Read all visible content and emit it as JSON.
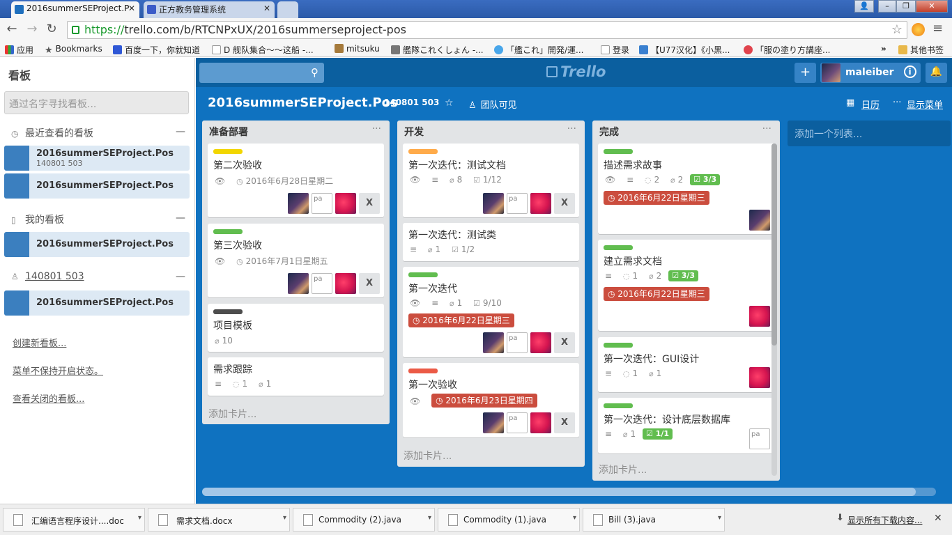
{
  "browser": {
    "tabs": [
      {
        "title": "2016summerSEProject.P",
        "active": true,
        "favicon": "trello-icon"
      },
      {
        "title": "正方教务管理系统",
        "active": false,
        "favicon": "jwxt-icon"
      }
    ],
    "url_https": "https://",
    "url_rest": "trello.com/b/RTCNPxUX/2016summerseproject-pos",
    "bookmarks": [
      {
        "label": "应用",
        "icon": "apps-icon"
      },
      {
        "label": "Bookmarks",
        "icon": "star-icon"
      },
      {
        "label": "百度一下，你就知道",
        "icon": "baidu-icon"
      },
      {
        "label": "D 舰队集合～～这船 -...",
        "icon": "page-icon"
      },
      {
        "label": "mitsuku",
        "icon": "mitsuku-icon"
      },
      {
        "label": "艦隊これくしょん -...",
        "icon": "kancolle-icon"
      },
      {
        "label": "「艦これ」開発/運...",
        "icon": "twitter-icon"
      },
      {
        "label": "登录",
        "icon": "page-icon"
      },
      {
        "label": "【U77汉化】《小黑...",
        "icon": "u77-icon"
      },
      {
        "label": "「服の塗り方講座...",
        "icon": "paint-icon"
      }
    ],
    "bookmarks_more": "»",
    "other_bookmarks": "其他书签"
  },
  "sidebar": {
    "title": "看板",
    "search_placeholder": "通过名字寻找看板...",
    "sections": [
      {
        "title": "最近查看的看板",
        "icon": "clock-icon",
        "underlined": false,
        "boards": [
          {
            "name": "2016summerSEProject.Pos",
            "sub": "140801 503"
          },
          {
            "name": "2016summerSEProject.Pos",
            "sub": ""
          }
        ]
      },
      {
        "title": "我的看板",
        "icon": "board-icon",
        "underlined": false,
        "boards": [
          {
            "name": "2016summerSEProject.Pos",
            "sub": ""
          }
        ]
      },
      {
        "title": "140801 503",
        "icon": "team-icon",
        "underlined": true,
        "boards": [
          {
            "name": "2016summerSEProject.Pos",
            "sub": ""
          }
        ]
      }
    ],
    "collapse_symbol": "—",
    "links": [
      "创建新看板...",
      "菜单不保持开启状态。",
      "查看关闭的看板..."
    ]
  },
  "header": {
    "logo_text": "Trello",
    "username": "maleiber",
    "add_symbol": "+",
    "info_symbol": "i",
    "bell_symbol": "🔔"
  },
  "board": {
    "title": "2016summerSEProject.Pos",
    "team": "140801 503",
    "visibility": "团队可见",
    "calendar": "日历",
    "show_menu": "显示菜单",
    "add_list": "添加一个列表...",
    "add_card": "添加卡片...",
    "list_menu": "···"
  },
  "lists": [
    {
      "title": "准备部署",
      "cards": [
        {
          "label_color": "#f2d600",
          "title": "第二次验收",
          "watch": true,
          "due": "2016年6月28日星期二",
          "due_style": "plain",
          "members": [
            "photo",
            "broken",
            "pink",
            "x"
          ]
        },
        {
          "label_color": "#61bd4f",
          "title": "第三次验收",
          "watch": true,
          "due": "2016年7月1日星期五",
          "due_style": "plain",
          "members": [
            "photo",
            "broken",
            "pink",
            "x"
          ]
        },
        {
          "label_color": "#4d4d4d",
          "title": "项目模板",
          "attachments": "10"
        },
        {
          "title": "需求跟踪",
          "desc": true,
          "comments": "1",
          "attachments": "1"
        }
      ]
    },
    {
      "title": "开发",
      "cards": [
        {
          "label_color": "#ffab4a",
          "title": "第一次迭代：测试文档",
          "watch": true,
          "desc": true,
          "attachments": "8",
          "checklist": "1/12",
          "members": [
            "photo",
            "broken",
            "pink",
            "x"
          ]
        },
        {
          "title": "第一次迭代：测试类",
          "desc": true,
          "attachments": "1",
          "checklist": "1/2"
        },
        {
          "label_color": "#61bd4f",
          "title": "第一次迭代",
          "watch": true,
          "desc": true,
          "attachments": "1",
          "checklist": "9/10",
          "due": "2016年6月22日星期三",
          "due_style": "red",
          "members": [
            "photo",
            "broken",
            "pink",
            "x"
          ]
        },
        {
          "label_color": "#eb5a46",
          "title": "第一次验收",
          "watch": true,
          "due": "2016年6月23日星期四",
          "due_style": "red",
          "members": [
            "photo",
            "broken",
            "pink",
            "x"
          ]
        }
      ]
    },
    {
      "title": "完成",
      "cards": [
        {
          "label_color": "#61bd4f",
          "title": "描述需求故事",
          "watch": true,
          "desc": true,
          "comments": "2",
          "attachments": "2",
          "checklist": "3/3",
          "checklist_done": true,
          "due": "2016年6月22日星期三",
          "due_style": "red",
          "members": [
            "photo"
          ]
        },
        {
          "label_color": "#61bd4f",
          "title": "建立需求文档",
          "desc": true,
          "comments": "1",
          "attachments": "2",
          "checklist": "3/3",
          "checklist_done": true,
          "due": "2016年6月22日星期三",
          "due_style": "red",
          "members": [
            "pink"
          ]
        },
        {
          "label_color": "#61bd4f",
          "title": "第一次迭代：GUI设计",
          "desc": true,
          "comments": "1",
          "attachments": "1",
          "members": [
            "pink"
          ]
        },
        {
          "label_color": "#61bd4f",
          "title": "第一次迭代：设计底层数据库",
          "desc": true,
          "attachments": "1",
          "checklist": "1/1",
          "checklist_done": true,
          "members": [
            "broken"
          ]
        }
      ]
    }
  ],
  "broken_image_alt": "pa",
  "downloads": {
    "items": [
      "汇编语言程序设计....doc",
      "需求文档.docx",
      "Commodity (2).java",
      "Commodity (1).java",
      "Bill (3).java"
    ],
    "show_all": "显示所有下载内容...",
    "close": "✕"
  },
  "colors": {
    "board_bg": "#0f72c0",
    "header_bg": "#0b5f9f",
    "due_red": "#cb4d3e",
    "check_green": "#61bd4f"
  }
}
